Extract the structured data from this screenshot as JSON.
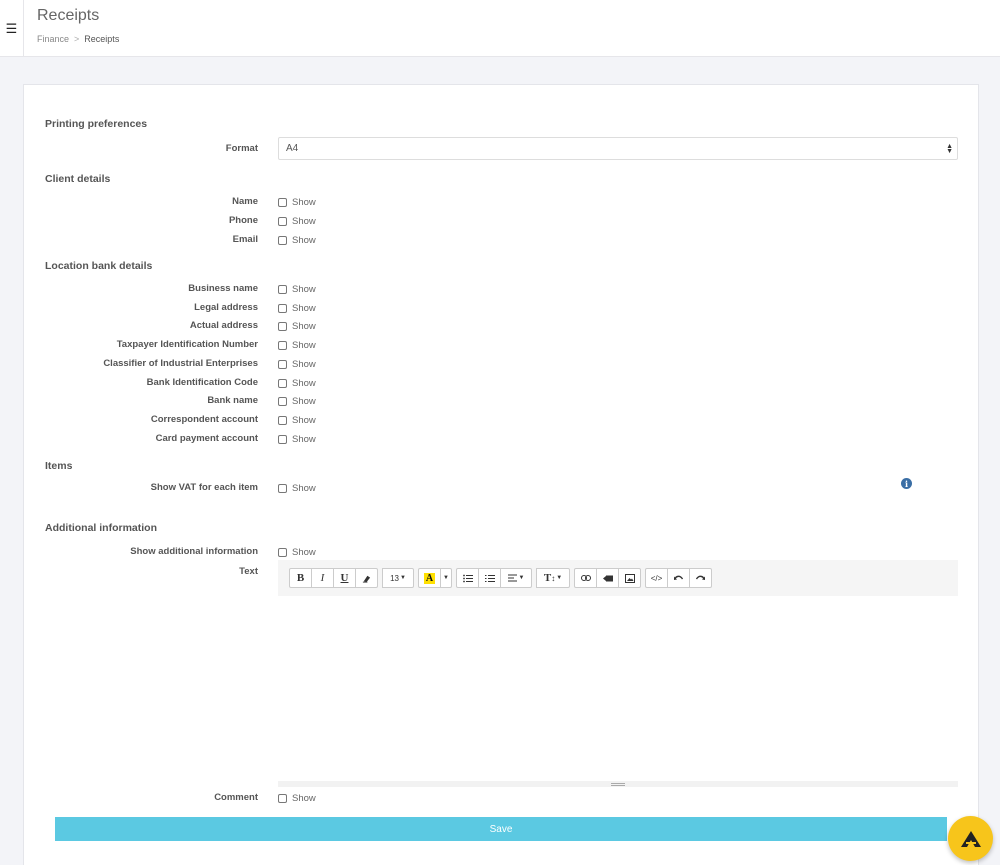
{
  "header": {
    "menu_icon": "hamburger-icon",
    "title": "Receipts",
    "breadcrumb": {
      "parent": "Finance",
      "separator": ">",
      "current": "Receipts"
    }
  },
  "sections": {
    "printing": "Printing preferences",
    "client": "Client details",
    "bank": "Location bank details",
    "items": "Items",
    "additional": "Additional information"
  },
  "format": {
    "label": "Format",
    "value": "A4"
  },
  "show_label": "Show",
  "client_rows": [
    "Name",
    "Phone",
    "Email"
  ],
  "bank_rows": [
    "Business name",
    "Legal address",
    "Actual address",
    "Taxpayer Identification Number",
    "Classifier of Industrial Enterprises",
    "Bank Identification Code",
    "Bank name",
    "Correspondent account",
    "Card payment account"
  ],
  "items_rows": [
    "Show VAT for each item"
  ],
  "additional_rows": [
    "Show additional information"
  ],
  "text_label": "Text",
  "comment_label": "Comment",
  "toolbar": {
    "bold": "B",
    "italic": "I",
    "underline": "U",
    "font_size": "13",
    "highlight": "A",
    "font_name": "T"
  },
  "save_label": "Save",
  "colors": {
    "accent": "#5bc9e2",
    "fab": "#f7c51b",
    "info": "#3a6ea5",
    "highlight": "#ffe000"
  }
}
